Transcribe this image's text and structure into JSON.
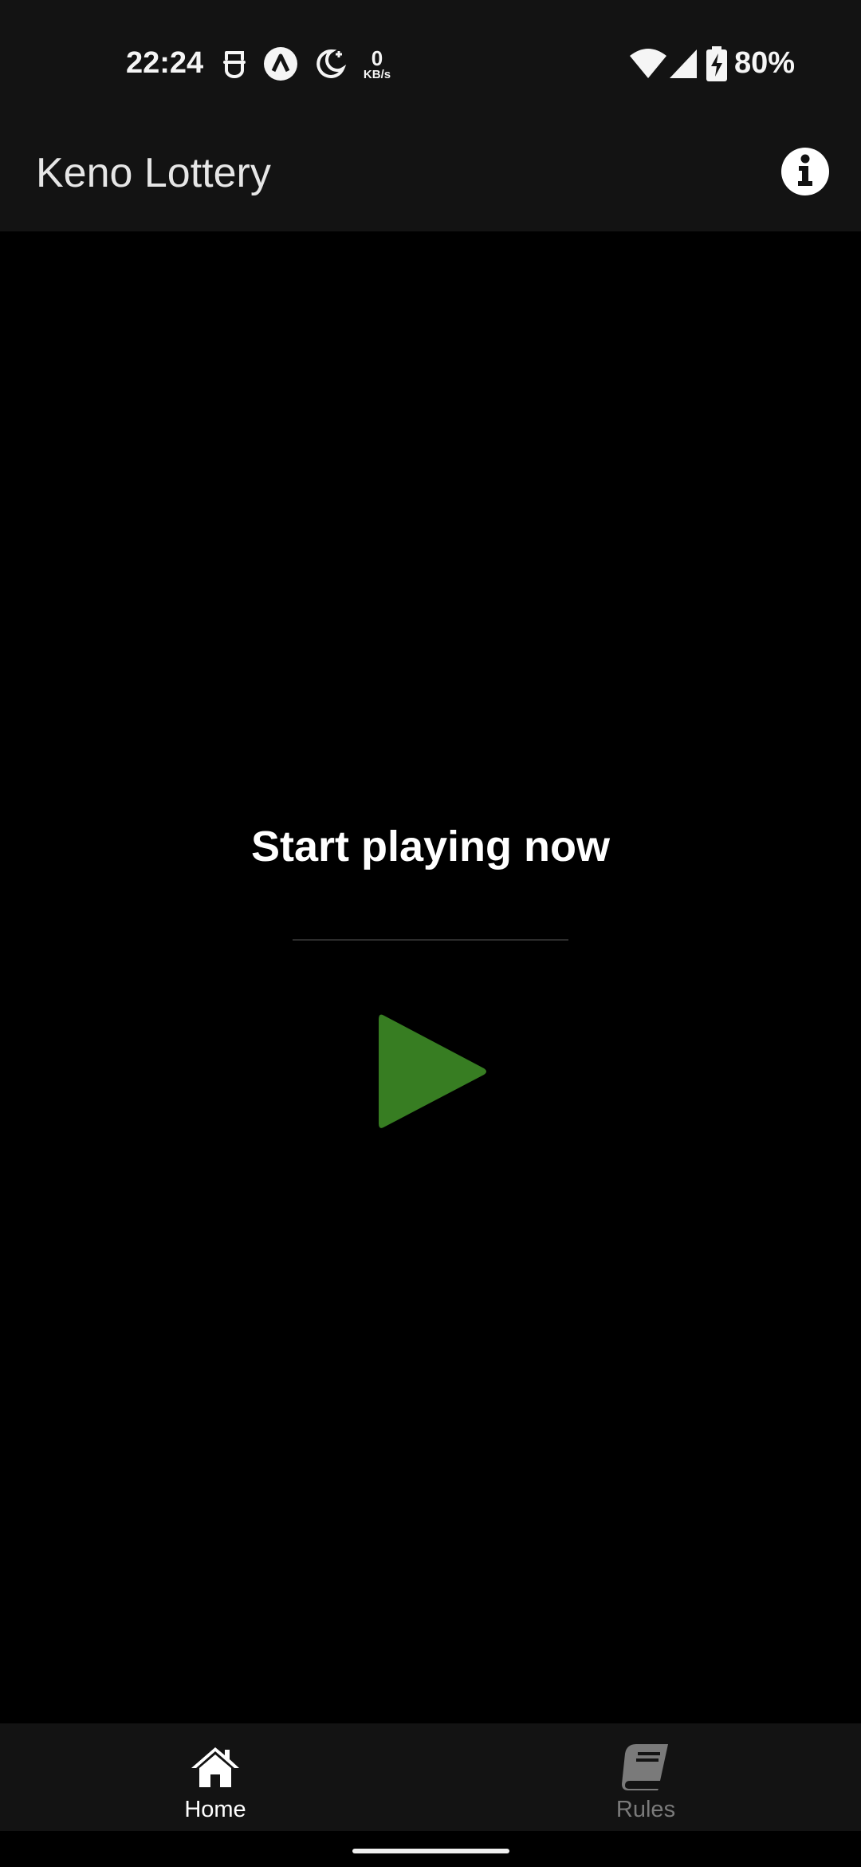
{
  "status_bar": {
    "time": "22:24",
    "net_speed_value": "0",
    "net_speed_unit": "KB/s",
    "battery": "80%",
    "icons": [
      "face-id-icon",
      "app-notification-icon",
      "do-not-disturb-moon-icon",
      "wifi-icon",
      "cellular-signal-icon",
      "battery-charging-icon"
    ]
  },
  "app_bar": {
    "title": "Keno Lottery",
    "info_icon": "info-icon"
  },
  "main": {
    "headline": "Start playing now",
    "play_icon": "play-icon",
    "play_color": "#377D22"
  },
  "bottom_nav": {
    "items": [
      {
        "label": "Home",
        "icon": "home-icon",
        "active": true
      },
      {
        "label": "Rules",
        "icon": "book-icon",
        "active": false
      }
    ]
  },
  "colors": {
    "background": "#000000",
    "bars": "#131313",
    "active_nav": "#FFFFFF",
    "inactive_nav": "#7A7A7A"
  }
}
